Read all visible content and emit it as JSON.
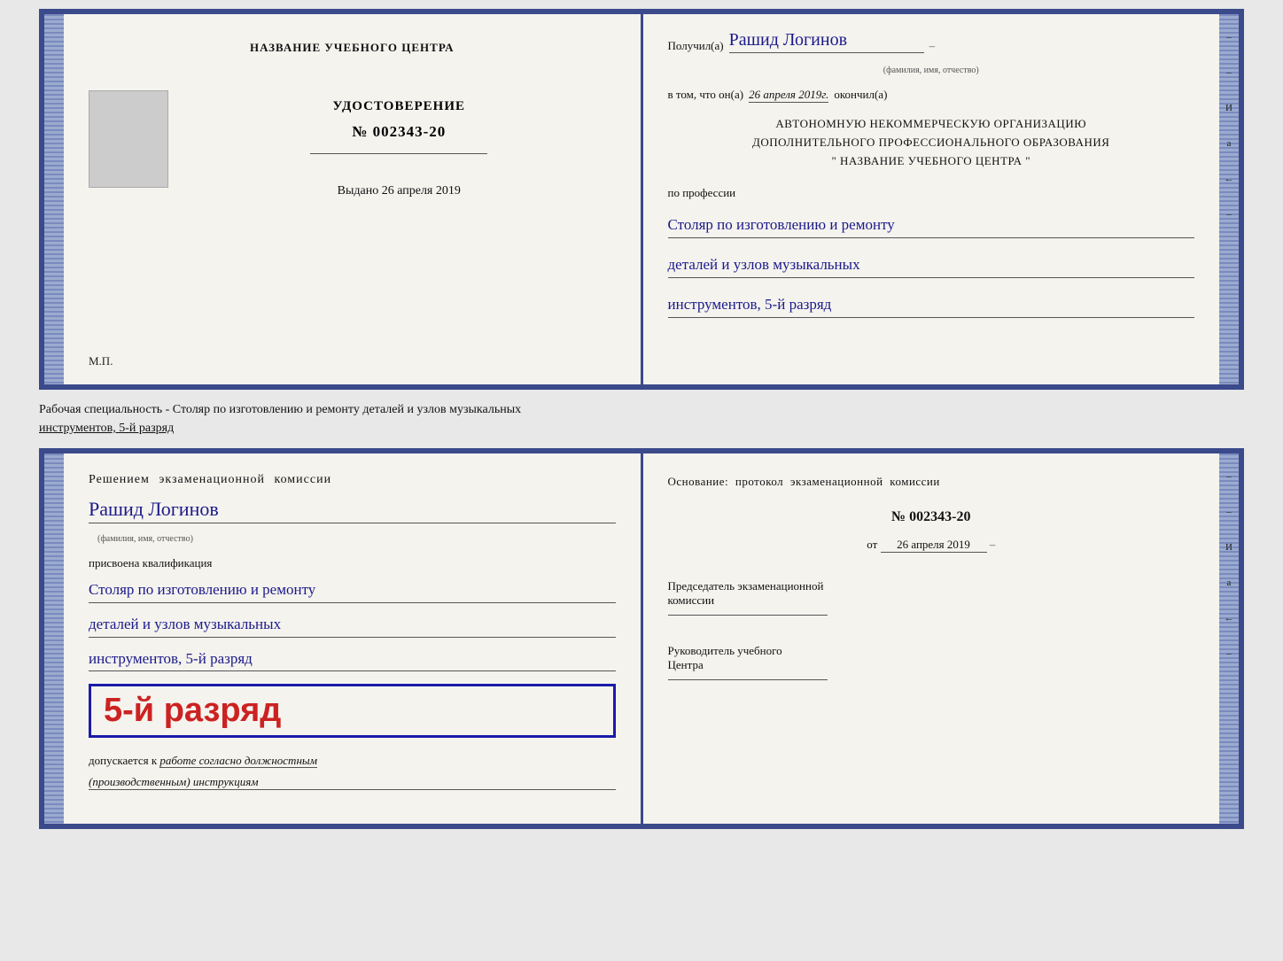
{
  "top_spread": {
    "left": {
      "center_title": "НАЗВАНИЕ УЧЕБНОГО ЦЕНТРА",
      "cert_label": "УДОСТОВЕРЕНИЕ",
      "cert_number": "№ 002343-20",
      "issued_label": "Выдано",
      "issued_date": "26 апреля 2019",
      "mp_label": "М.П."
    },
    "right": {
      "received_prefix": "Получил(а)",
      "recipient_name": "Рашид Логинов",
      "fio_label": "(фамилия, имя, отчество)",
      "dash": "–",
      "in_that_prefix": "в том, что он(а)",
      "date_value": "26 апреля 2019г.",
      "finished_label": "окончил(а)",
      "org_line1": "АВТОНОМНУЮ НЕКОММЕРЧЕСКУЮ ОРГАНИЗАЦИЮ",
      "org_line2": "ДОПОЛНИТЕЛЬНОГО ПРОФЕССИОНАЛЬНОГО ОБРАЗОВАНИЯ",
      "org_line3": "\"  НАЗВАНИЕ УЧЕБНОГО ЦЕНТРА  \"",
      "profession_label": "по профессии",
      "profession_line1": "Столяр по изготовлению и ремонту",
      "profession_line2": "деталей и узлов музыкальных",
      "profession_line3": "инструментов, 5-й разряд"
    }
  },
  "between_text": "Рабочая специальность - Столяр по изготовлению и ремонту деталей и узлов музыкальных",
  "between_text2": "инструментов, 5-й разряд",
  "bottom_spread": {
    "left": {
      "komissia_title": "Решением экзаменационной комиссии",
      "recipient_name": "Рашид Логинов",
      "fio_label": "(фамилия, имя, отчество)",
      "assigned_label": "присвоена квалификация",
      "qual_line1": "Столяр по изготовлению и ремонту",
      "qual_line2": "деталей и узлов музыкальных",
      "qual_line3": "инструментов, 5-й разряд",
      "big_grade": "5-й разряд",
      "допуск_prefix": "допускается к",
      "допуск_italic": "работе согласно должностным",
      "допуск_italic2": "(производственным) инструкциям"
    },
    "right": {
      "osnov_label": "Основание: протокол экзаменационной комиссии",
      "protocol_number": "№  002343-20",
      "ot_label": "от",
      "ot_date": "26 апреля 2019",
      "chairman_title": "Председатель экзаменационной",
      "chairman_title2": "комиссии",
      "director_title": "Руководитель учебного",
      "director_title2": "Центра"
    }
  },
  "right_edge_chars": [
    "–",
    "–",
    "И",
    "а",
    "←",
    "–"
  ]
}
